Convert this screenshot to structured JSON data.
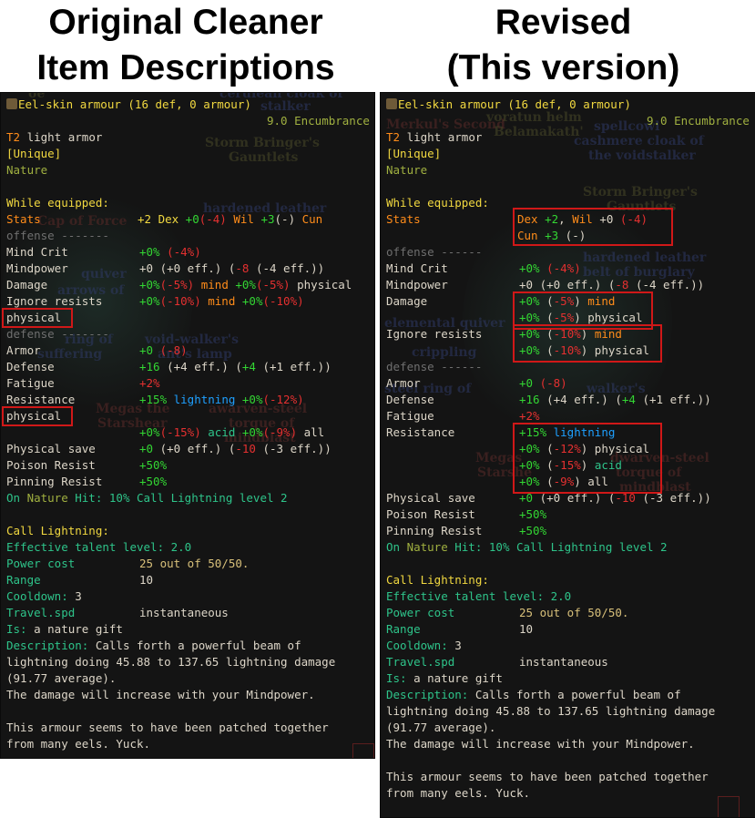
{
  "headings": {
    "left": [
      "Original Cleaner",
      "Item Descriptions"
    ],
    "right": [
      "Revised",
      "(This version)"
    ]
  },
  "item": {
    "title": "Eel-skin armour (16 def, 0 armour)",
    "encumbrance": "9.0 Encumbrance",
    "tier": "T2",
    "type": "light armor",
    "unique": "[Unique]",
    "school": "Nature",
    "while_equipped": "While equipped:"
  },
  "labels": {
    "stats": "Stats",
    "offense": "offense -------",
    "offense_r": "offense ------",
    "mind_crit": "Mind Crit",
    "mindpower": "Mindpower",
    "damage": "Damage",
    "ignore_resists": "Ignore resists",
    "physical": "physical",
    "defense": "defense -------",
    "defense_r": "defense ------",
    "armor": "Armor",
    "defense_stat": "Defense",
    "fatigue": "Fatigue",
    "resistance": "Resistance",
    "physical_save": "Physical save",
    "poison_resist": "Poison Resist",
    "pinning_resist": "Pinning Resist"
  },
  "values": {
    "stats_left": {
      "dex": "+2 Dex",
      "wil": " +0",
      "wil_red": "(-4)",
      "wil_name": " Wil",
      "cun": " +3",
      "cun_paren": "(-)",
      "cun_name": " Cun"
    },
    "mind_crit_plus": "+0%",
    "mind_crit_red": "(-4%)",
    "mindpower_a": "+0 (+0 eff.) (",
    "mindpower_red": "-8",
    "mindpower_b": " (-4 eff.))",
    "damage_l": {
      "a": "+0%",
      "b": "(-5%)",
      "c": " mind ",
      "d": "+0%",
      "e": "(-5%)",
      "f": " physical"
    },
    "ignore_l": {
      "a": "+0%",
      "b": "(-10%)",
      "c": " mind ",
      "d": "+0%",
      "e": "(-10%)"
    },
    "armor_plus": "+0",
    "armor_red": "(-8)",
    "defense_val": {
      "a": "+16",
      "b": " (+4 eff.) (",
      "c": "+4",
      "d": " (+1 eff.))"
    },
    "fatigue": "+2%",
    "resist_l": {
      "a": "+15%",
      "b": " lightning ",
      "c": "+0%",
      "d": "(-12%)"
    },
    "resist_l2": {
      "a": "+0%",
      "b": "(-15%)",
      "c": " acid ",
      "d": "+0%",
      "e": "(-9%)",
      "f": " all"
    },
    "physical_save": {
      "a": "+0",
      "b": " (+0 eff.) (",
      "c": "-10",
      "d": " (-3 eff.))"
    },
    "poison_resist": "+50%",
    "pinning_resist": "+50%",
    "on_hit": {
      "a": "On ",
      "b": "Nature",
      "c": " Hit: ",
      "d": "10% Call Lightning level 2"
    },
    "stats_right": {
      "dex": "Dex",
      "dex_v": " +2",
      "comma": ", ",
      "wil": "Wil",
      "wil_v": " +0 ",
      "wil_red": "(-4)",
      "cun": "Cun",
      "cun_v": " +3",
      "cun_paren": " (-)"
    },
    "damage_r1": {
      "a": "+0%",
      "b": " (",
      "c": "-5%",
      "d": ") ",
      "e": "mind"
    },
    "damage_r2": {
      "a": "+0%",
      "b": " (",
      "c": "-5%",
      "d": ") physical"
    },
    "ignore_r1": {
      "a": "+0%",
      "b": " (",
      "c": "-10%",
      "d": ") ",
      "e": "mind"
    },
    "ignore_r2": {
      "a": "+0%",
      "b": " (",
      "c": "-10%",
      "d": ") physical"
    },
    "resist_r1": {
      "a": "+15%",
      "b": " lightning"
    },
    "resist_r2": {
      "a": "+0%",
      "b": " (",
      "c": "-12%",
      "d": ") physical"
    },
    "resist_r3": {
      "a": "+0%",
      "b": " (",
      "c": "-15%",
      "d": ") ",
      "e": "acid"
    },
    "resist_r4": {
      "a": "+0%",
      "b": " (",
      "c": "-9%",
      "d": ") all"
    }
  },
  "talent": {
    "name": "Call Lightning:",
    "effective": "Effective talent level: 2.0",
    "power_label": "Power cost",
    "power_value": "25 out of 50/50.",
    "range_label": "Range",
    "range_value": "10",
    "cooldown_label": "Cooldown:",
    "cooldown_value": " 3",
    "travel_label": "Travel.spd",
    "travel_value": "instantaneous",
    "is_label": "Is:",
    "is_value": " a nature gift",
    "desc_label": "Description:",
    "desc_1": " Calls forth a powerful beam of",
    "desc_2": "lightning doing 45.88 to 137.65 lightning damage",
    "desc_3": "(91.77 average).",
    "desc_4": "The damage will increase with your Mindpower.",
    "flavor_1": "This armour seems to have been patched together",
    "flavor_2": "from many eels. Yuck."
  },
  "background_left": [
    "oe",
    "cerulean cloak of",
    "stalker",
    "Storm Bringer's",
    "Gauntlets",
    "hardened leather",
    "ht",
    "Cap of Force",
    "quiver",
    "arrows of",
    "ring of",
    "suffering",
    "void-walker's",
    "ant's lamp",
    "Megas the",
    "Starshear",
    "awarven-steel",
    "torque of",
    "mindblast",
    "incapacitation"
  ],
  "background_right": [
    "Merkul's Second",
    "voratun helm",
    "Belamakath'",
    "spellcowl",
    "cashmere cloak of",
    "the voidstalker",
    "Storm Bringer's",
    "Gauntlets",
    "hardened leather",
    "belt of burglary",
    "Cap of Force",
    "elemental quiver",
    "crippling",
    "ugh",
    "ner boots",
    "mbat",
    "steel ring of",
    "suffering",
    "walker's",
    "of clarity",
    "Megas",
    "Starshe",
    "dwarven-steel",
    "torque of",
    "mindblast",
    "incapacitation"
  ],
  "colors": {
    "panel_bg": "#141414",
    "highlight": "#d01818",
    "title": "#f2d940",
    "stat_orange": "#ff8c1a",
    "positive": "#33d633",
    "negative": "#e53030",
    "lightning": "#1ea0ff"
  }
}
